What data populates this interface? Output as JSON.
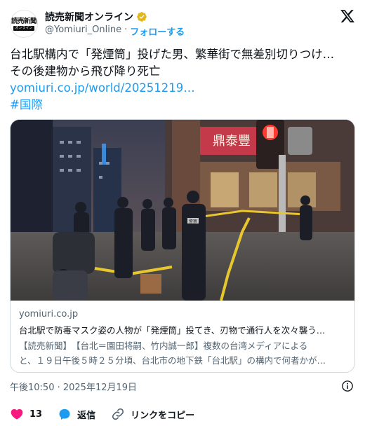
{
  "account": {
    "logo_text": "読売新聞",
    "logo_sub": "オンライン",
    "display_name": "読売新聞オンライン",
    "handle": "@Yomiuri_Online",
    "separator": "·",
    "follow_label": "フォローする"
  },
  "tweet": {
    "line1": "台北駅構内で「発煙筒」投げた男、繁華街で無差別切りつけ…",
    "line2": "その後建物から飛び降り死亡",
    "link": "yomiuri.co.jp/world/20251219…",
    "hashtag": "#国際"
  },
  "card": {
    "domain": "yomiuri.co.jp",
    "title": "台北駅で防毒マスク姿の人物が「発煙筒」投てき、刃物で通行人を次々襲う…",
    "desc_line1": "【読売新聞】　【台北＝園田将嗣、竹内誠一郎】複数の台湾メディアによる",
    "desc_line2": "と、１９日午後５時２５分頃、台北市の地下鉄「台北駅」の構内で何者かが…",
    "photo_sign_text": "鼎泰豐",
    "police_patch": "警察"
  },
  "meta": {
    "timestamp": "午後10:50 · 2025年12月19日"
  },
  "actions": {
    "like_count": "13",
    "reply_label": "返信",
    "copy_link_label": "リンクをコピー"
  },
  "colors": {
    "accent": "#1d9bf0",
    "like": "#f91880",
    "verified": "#e2b719",
    "muted": "#536471"
  },
  "icons": [
    "verified-badge-icon",
    "x-logo-icon",
    "info-icon",
    "heart-icon",
    "reply-icon",
    "link-icon"
  ]
}
